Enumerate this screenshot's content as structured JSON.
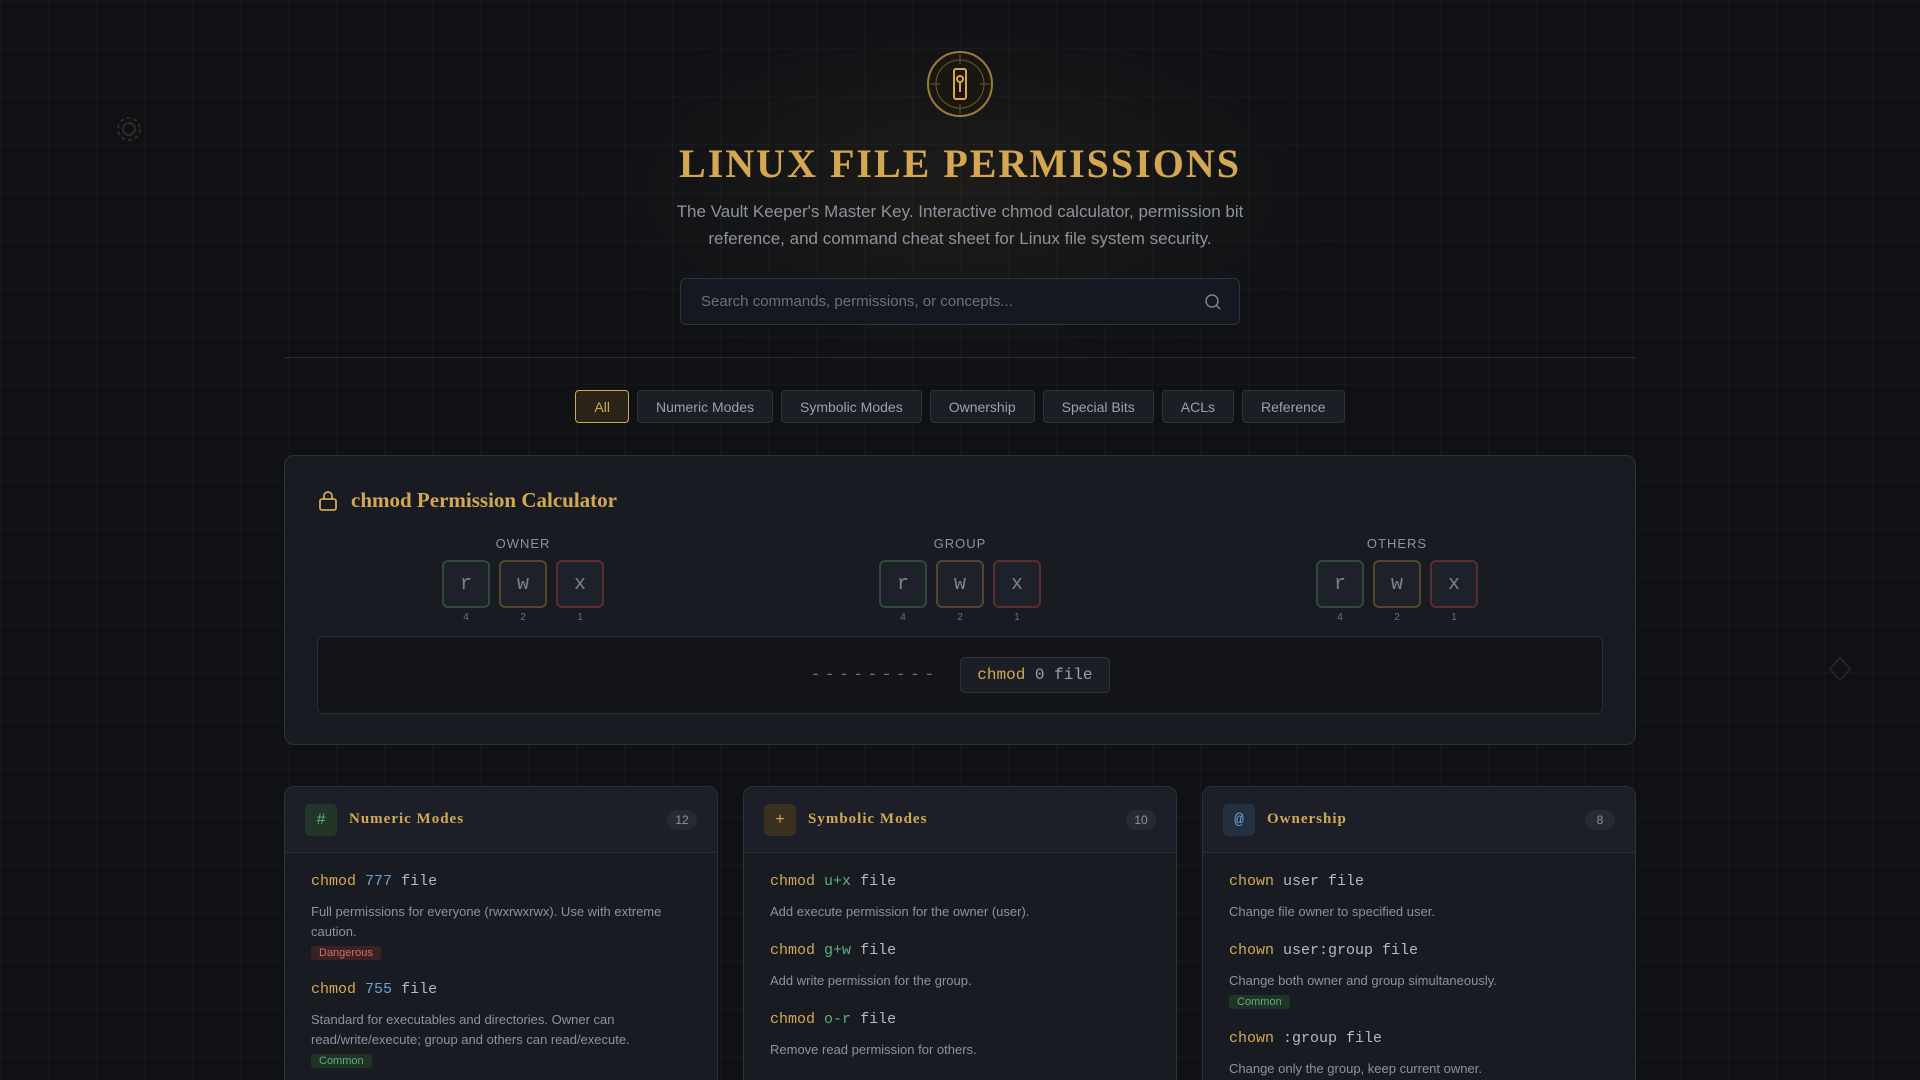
{
  "header": {
    "title": "LINUX FILE PERMISSIONS",
    "subtitle": "The Vault Keeper's Master Key. Interactive chmod calculator, permission bit reference, and command cheat sheet for Linux file system security.",
    "search_placeholder": "Search commands, permissions, or concepts...",
    "search_value": ""
  },
  "tabs": [
    {
      "label": "All",
      "active": true
    },
    {
      "label": "Numeric Modes",
      "active": false
    },
    {
      "label": "Symbolic Modes",
      "active": false
    },
    {
      "label": "Ownership",
      "active": false
    },
    {
      "label": "Special Bits",
      "active": false
    },
    {
      "label": "ACLs",
      "active": false
    },
    {
      "label": "Reference",
      "active": false
    }
  ],
  "calculator": {
    "title": "chmod Permission Calculator",
    "groups": [
      {
        "label": "OWNER",
        "bits": [
          {
            "letter": "r",
            "value": "4"
          },
          {
            "letter": "w",
            "value": "2"
          },
          {
            "letter": "x",
            "value": "1"
          }
        ]
      },
      {
        "label": "GROUP",
        "bits": [
          {
            "letter": "r",
            "value": "4"
          },
          {
            "letter": "w",
            "value": "2"
          },
          {
            "letter": "x",
            "value": "1"
          }
        ]
      },
      {
        "label": "OTHERS",
        "bits": [
          {
            "letter": "r",
            "value": "4"
          },
          {
            "letter": "w",
            "value": "2"
          },
          {
            "letter": "x",
            "value": "1"
          }
        ]
      }
    ],
    "symbolic": "---------",
    "command": {
      "keyword": "chmod",
      "mode": "0",
      "target": "file"
    }
  },
  "cards": [
    {
      "icon": "#",
      "title": "Numeric Modes",
      "count": "12",
      "entries": [
        {
          "cmd": "chmod",
          "arg": "777",
          "target": "file",
          "desc": "Full permissions for everyone (rwxrwxrwx). Use with extreme caution.",
          "badge": "Dangerous"
        },
        {
          "cmd": "chmod",
          "arg": "755",
          "target": "file",
          "desc": "Standard for executables and directories. Owner can read/write/execute; group and others can read/execute.",
          "badge": "Common"
        }
      ]
    },
    {
      "icon": "+",
      "title": "Symbolic Modes",
      "count": "10",
      "entries": [
        {
          "cmd": "chmod",
          "arg": "u+x",
          "target": "file",
          "desc": "Add execute permission for the owner (user)."
        },
        {
          "cmd": "chmod",
          "arg": "g+w",
          "target": "file",
          "desc": "Add write permission for the group."
        },
        {
          "cmd": "chmod",
          "arg": "o-r",
          "target": "file",
          "desc": "Remove read permission for others."
        }
      ]
    },
    {
      "icon": "@",
      "title": "Ownership",
      "count": "8",
      "entries": [
        {
          "cmd": "chown",
          "arg": "user file",
          "desc": "Change file owner to specified user."
        },
        {
          "cmd": "chown",
          "arg": "user:group file",
          "desc": "Change both owner and group simultaneously.",
          "badge": "Common"
        },
        {
          "cmd": "chown",
          "arg": ":group file",
          "desc": "Change only the group, keep current owner."
        }
      ]
    }
  ],
  "colors": {
    "accent": "#d4a853",
    "danger": "#d06a6f",
    "success": "#5fae78",
    "info": "#6f9ed1"
  }
}
